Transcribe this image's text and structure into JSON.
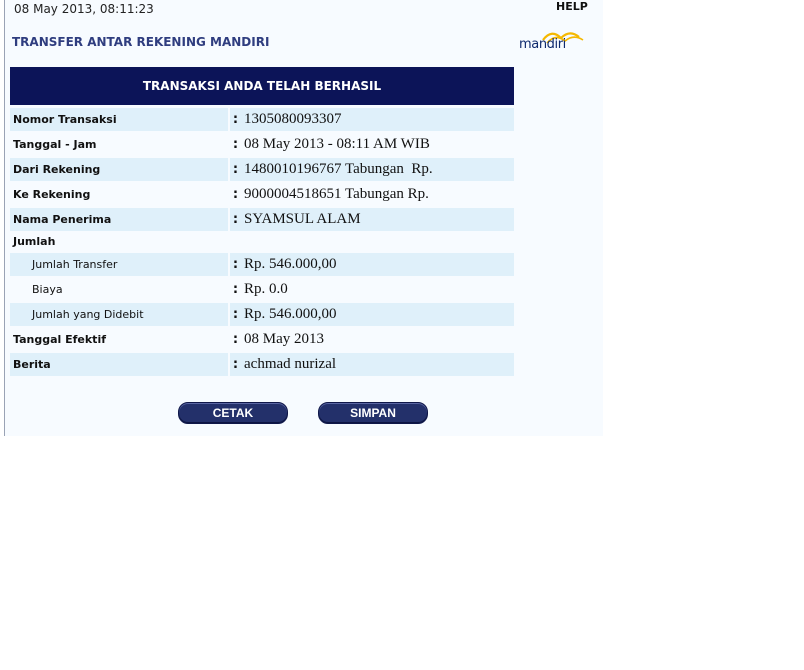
{
  "header": {
    "datetime": "08 May 2013, 08:11:23",
    "help_label": "HELP",
    "page_title": "TRANSFER ANTAR REKENING MANDIRI",
    "logo_text": "mandiri"
  },
  "result": {
    "title": "TRANSAKSI ANDA TELAH BERHASIL"
  },
  "details": {
    "nomor_transaksi": {
      "label": "Nomor Transaksi",
      "value": "1305080093307"
    },
    "tanggal_jam": {
      "label": "Tanggal - Jam",
      "value": "08 May 2013 - 08:11 AM WIB"
    },
    "dari_rekening": {
      "label": "Dari Rekening",
      "value": "1480010196767 Tabungan  Rp."
    },
    "ke_rekening": {
      "label": "Ke Rekening",
      "value": "9000004518651 Tabungan Rp."
    },
    "nama_penerima": {
      "label": "Nama Penerima",
      "value": "SYAMSUL ALAM"
    },
    "jumlah": {
      "label": "Jumlah"
    },
    "jumlah_transfer": {
      "label": "Jumlah Transfer",
      "value": "Rp. 546.000,00"
    },
    "biaya": {
      "label": "Biaya",
      "value": "Rp. 0.0"
    },
    "jumlah_didebit": {
      "label": "Jumlah yang Didebit",
      "value": "Rp. 546.000,00"
    },
    "tanggal_efektif": {
      "label": "Tanggal Efektif",
      "value": "08 May 2013"
    },
    "berita": {
      "label": "Berita",
      "value": "achmad nurizal"
    },
    "separator": ":"
  },
  "actions": {
    "cetak_label": "CETAK",
    "simpan_label": "SIMPAN"
  },
  "colors": {
    "header_bg": "#0c1458",
    "row_shade": "#dff0fa",
    "title_color": "#2f3d7f",
    "logo_accent": "#f5b800"
  }
}
